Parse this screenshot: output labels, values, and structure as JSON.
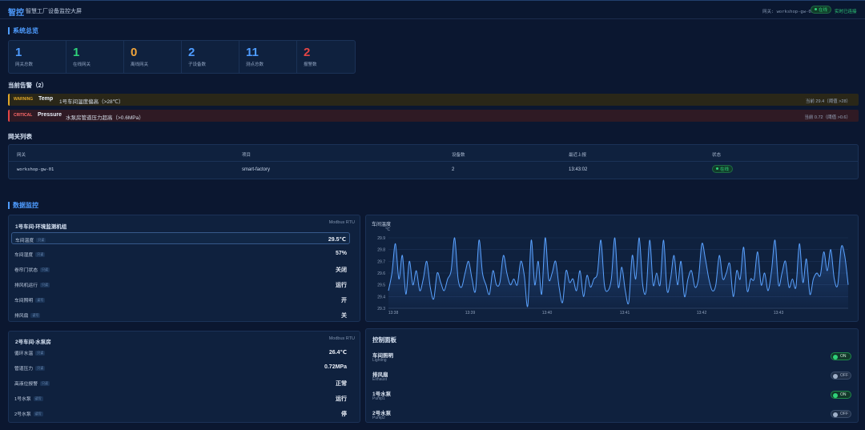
{
  "header": {
    "brand": "智控",
    "title": "智慧工厂设备监控大屏",
    "gateway_label": "网关: workshop-gw-01",
    "gateway_status": "在线",
    "connection": "实时已连接"
  },
  "overview": {
    "title": "系统总览",
    "stats": [
      {
        "value": "1",
        "label": "网关总数",
        "color": "#4e9cff"
      },
      {
        "value": "1",
        "label": "在线网关",
        "color": "#2fd27a"
      },
      {
        "value": "0",
        "label": "离线网关",
        "color": "#f0a43a"
      },
      {
        "value": "2",
        "label": "子设备数",
        "color": "#4e9cff"
      },
      {
        "value": "11",
        "label": "测点总数",
        "color": "#4e9cff"
      },
      {
        "value": "2",
        "label": "报警数",
        "color": "#e24545"
      }
    ]
  },
  "alarms": {
    "title": "当前告警（2）",
    "items": [
      {
        "level": "WARNING",
        "tag": "Temp",
        "message": "1号车间温度偏高（>28℃）",
        "current": "当前 29.4（阈值 >28）"
      },
      {
        "level": "CRITICAL",
        "tag": "Pressure",
        "message": "水泵房管道压力超高（>0.6MPa）",
        "current": "当前 0.72（阈值 >0.6）"
      }
    ]
  },
  "gateways": {
    "title": "网关列表",
    "columns": [
      "网关",
      "项目",
      "设备数",
      "最近上报",
      "状态"
    ],
    "rows": [
      {
        "gateway": "workshop-gw-01",
        "project": "smart-factory",
        "devices": "2",
        "last_report": "13:43:02",
        "status": "在线"
      }
    ]
  },
  "monitor": {
    "title": "数据监控",
    "device1": {
      "name": "1号车间-环境监测机组",
      "protocol": "Modbus RTU",
      "points": [
        {
          "name": "车间温度",
          "badge": "只读",
          "value": "29.5℃"
        },
        {
          "name": "车间湿度",
          "badge": "只读",
          "value": "57%"
        },
        {
          "name": "卷帘门状态",
          "badge": "只读",
          "value": "关闭"
        },
        {
          "name": "排风机运行",
          "badge": "只读",
          "value": "运行"
        },
        {
          "name": "车间照明",
          "badge": "读写",
          "value": "开"
        },
        {
          "name": "排风扇",
          "badge": "读写",
          "value": "关"
        }
      ]
    },
    "device2": {
      "name": "2号车间-水泵房",
      "protocol": "Modbus RTU",
      "points": [
        {
          "name": "循环水温",
          "badge": "只读",
          "value": "26.4℃"
        },
        {
          "name": "管道压力",
          "badge": "只读",
          "value": "0.72MPa"
        },
        {
          "name": "高液位报警",
          "badge": "只读",
          "value": "正常"
        },
        {
          "name": "1号水泵",
          "badge": "读写",
          "value": "运行"
        },
        {
          "name": "2号水泵",
          "badge": "读写",
          "value": "停"
        }
      ]
    }
  },
  "chart_data": {
    "type": "line",
    "title": "车间温度",
    "ylabel": "℃",
    "xlabel": "",
    "ylim": [
      29.3,
      29.9
    ],
    "yticks": [
      "29.9",
      "29.8",
      "29.7",
      "29.6",
      "29.5",
      "29.4",
      "29.3"
    ],
    "xticks": [
      "13:38",
      "13:39",
      "13:40",
      "13:41",
      "13:42",
      "13:43"
    ],
    "grid": true,
    "series": [
      {
        "values": [
          29.45,
          29.6,
          29.85,
          29.55,
          29.75,
          29.42,
          29.7,
          29.5,
          29.62,
          29.45,
          29.55,
          29.7,
          29.48,
          29.38,
          29.6,
          29.52,
          29.45,
          29.55,
          29.62,
          29.9,
          29.55,
          29.48,
          29.6,
          29.7,
          29.55,
          29.45,
          29.88,
          29.6,
          29.5,
          29.42,
          29.62,
          29.5,
          29.52,
          29.75,
          29.6,
          29.5,
          29.55,
          29.5,
          29.7,
          29.58,
          29.32,
          29.88,
          29.5,
          29.7,
          29.42,
          29.9,
          29.55,
          29.6,
          29.7,
          29.48,
          29.35,
          29.62,
          29.52,
          29.55,
          29.45,
          29.62,
          29.4,
          29.58,
          29.48,
          29.55,
          29.6,
          29.88,
          29.5,
          29.45,
          29.55,
          29.9,
          29.48,
          29.65,
          29.45,
          29.35,
          29.75,
          29.55,
          29.9,
          29.5,
          29.45,
          29.88,
          29.5,
          29.6,
          29.5,
          29.88,
          29.45,
          29.55,
          29.75,
          29.5,
          29.7,
          29.4,
          29.55,
          29.62,
          29.48,
          29.55,
          29.85,
          29.72,
          29.55,
          29.45,
          29.5,
          29.75,
          29.55,
          29.6,
          29.68,
          29.4,
          29.62,
          29.55,
          29.82,
          29.45,
          29.55,
          29.55,
          29.78,
          29.5,
          29.6,
          29.45,
          29.62,
          29.88,
          29.5,
          29.6,
          29.7,
          29.48,
          29.55,
          29.48,
          29.85,
          29.52,
          29.72,
          29.42,
          29.55,
          29.6,
          29.58,
          29.78,
          29.62,
          29.8,
          29.55,
          29.5,
          29.82,
          29.75,
          29.5
        ]
      }
    ]
  },
  "control": {
    "title": "控制面板",
    "items": [
      {
        "name": "车间照明",
        "sub": "Lighting",
        "state": "ON"
      },
      {
        "name": "排风扇",
        "sub": "Exhaust",
        "state": "OFF"
      },
      {
        "name": "1号水泵",
        "sub": "Pump1",
        "state": "ON"
      },
      {
        "name": "2号水泵",
        "sub": "Pump2",
        "state": "OFF"
      }
    ]
  }
}
